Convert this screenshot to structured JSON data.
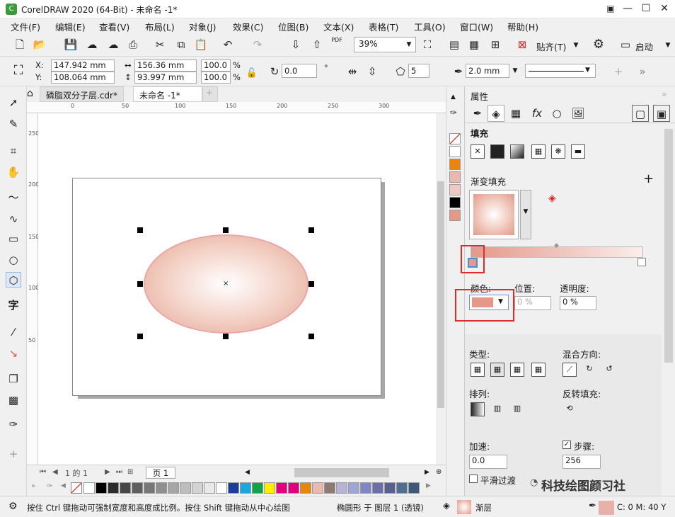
{
  "window": {
    "title": "CorelDRAW 2020 (64-Bit) - 未命名 -1*"
  },
  "menu": [
    "文件(F)",
    "编辑(E)",
    "查看(V)",
    "布局(L)",
    "对象(J)",
    "效果(C)",
    "位图(B)",
    "文本(X)",
    "表格(T)",
    "工具(O)",
    "窗口(W)",
    "帮助(H)"
  ],
  "toolbar": {
    "zoom": "39%",
    "align_label": "贴齐(T)",
    "launch_label": "启动",
    "pdf_label": "PDF"
  },
  "propbar": {
    "x_label": "X:",
    "y_label": "Y:",
    "x": "147.942 mm",
    "y": "108.064 mm",
    "w": "156.36 mm",
    "h": "93.997 mm",
    "scale_w": "100.0",
    "scale_h": "100.0",
    "pct": "%",
    "rotation": "0.0",
    "deg": "°",
    "polygon_sides": "5",
    "outline_width": "2.0 mm"
  },
  "tabs": {
    "doc1": "磷脂双分子层.cdr*",
    "doc2": "未命名 -1*",
    "add": "+"
  },
  "ruler": {
    "h": [
      "0",
      "50",
      "100",
      "150",
      "200",
      "250",
      "300"
    ],
    "v": [
      "250",
      "200",
      "150",
      "100",
      "50"
    ]
  },
  "pagenav": {
    "of": "1 的 1",
    "page": "页 1"
  },
  "panel": {
    "title": "属性",
    "fill_title": "填充",
    "gradient_title": "渐变填充",
    "color_label": "颜色:",
    "position_label": "位置:",
    "transparency_label": "透明度:",
    "position_value": "0 %",
    "transparency_value": "0 %",
    "type_label": "类型:",
    "blend_dir_label": "混合方向:",
    "arrange_label": "排列:",
    "reverse_label": "反转填充:",
    "accel_label": "加速:",
    "steps_label": "步骤:",
    "accel_value": "0.0",
    "steps_value": "256",
    "smooth_label": "平滑过渡"
  },
  "status": {
    "hint": "按住 Ctrl 键拖动可强制宽度和高度成比例。按住 Shift 键拖动从中心绘图",
    "object_info": "椭圆形 于 图层 1 (透镜)",
    "fill_type": "渐层",
    "outline_info": "C: 0 M: 40 Y",
    "watermark": "科技绘图颜习社"
  },
  "colors": {
    "accent": "#e32a2a",
    "stop_color": "#e3988a",
    "ellipse_edge": "#eba6a6",
    "orange": "#e8850c"
  },
  "palette_h": [
    "#ffffff",
    "#000000",
    "#2b2b2b",
    "#464646",
    "#5e5e5e",
    "#777777",
    "#8f8f8f",
    "#a6a6a6",
    "#bdbdbd",
    "#d3d3d3",
    "#e9e9e9",
    "#ffffff",
    "#1b3d9c",
    "#1aa7e0",
    "#12a24b",
    "#ffee00",
    "#e5007e",
    "#e3007e",
    "#e8850c",
    "#e9b9b0",
    "#8c7b72",
    "#b7b3d6",
    "#9ea7d3",
    "#7f86c1",
    "#6a6fa9",
    "#5b5f8f",
    "#4f6e92",
    "#3e5878"
  ],
  "palette_v": [
    "#ffffff",
    "#e8850c",
    "#e9b9b0",
    "#f0c9c3",
    "#000000",
    "#e3988a"
  ]
}
